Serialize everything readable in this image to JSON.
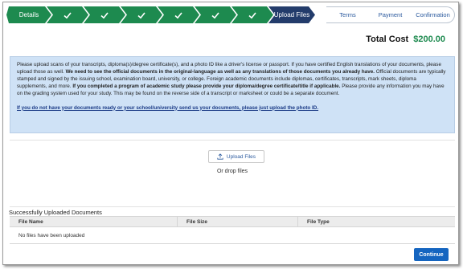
{
  "stepper": {
    "steps": [
      {
        "label": "Details"
      },
      {
        "label": ""
      },
      {
        "label": ""
      },
      {
        "label": ""
      },
      {
        "label": ""
      },
      {
        "label": ""
      },
      {
        "label": ""
      },
      {
        "label": "Upload Files"
      },
      {
        "label": "Terms"
      },
      {
        "label": "Payment"
      },
      {
        "label": "Confirmation"
      }
    ]
  },
  "total": {
    "label": "Total Cost",
    "amount": "$200.00"
  },
  "info": {
    "p1": "Please upload scans of your transcripts, diploma(s)/degree certificate(s), and a photo ID like a driver's license or passport. If you have certified English translations of your documents, please upload those as well.",
    "b1": "We need to see the official documents in the original-language as well as any translations of those documents you already have.",
    "p2": "Official documents are typically stamped and signed by the issuing school, examination board, university, or college. Foreign academic documents include diplomas, certificates, transcripts, mark sheets, diploma supplements, and more.",
    "b2": "If you completed a program of academic study please provide your diploma/degree certificate/title if applicable.",
    "p3": "Please provide any information you may have on the grading system used for your study. This may be found on the reverse side of a transcript or marksheet or could be a separate document.",
    "link": "If you do not have your documents ready or your school/university send us your documents, please just upload the photo ID."
  },
  "upload": {
    "button_label": "Upload Files",
    "drop_text": "Or drop files"
  },
  "docs": {
    "title": "Successfully Uploaded Documents",
    "columns": [
      "File Name",
      "File Size",
      "File Type"
    ],
    "empty_text": "No files have been uploaded"
  },
  "actions": {
    "continue_label": "Continue"
  },
  "colors": {
    "green": "#1d8a4f",
    "navy": "#233c6b",
    "info_bg": "#cfe2f6",
    "primary": "#1565c0"
  }
}
